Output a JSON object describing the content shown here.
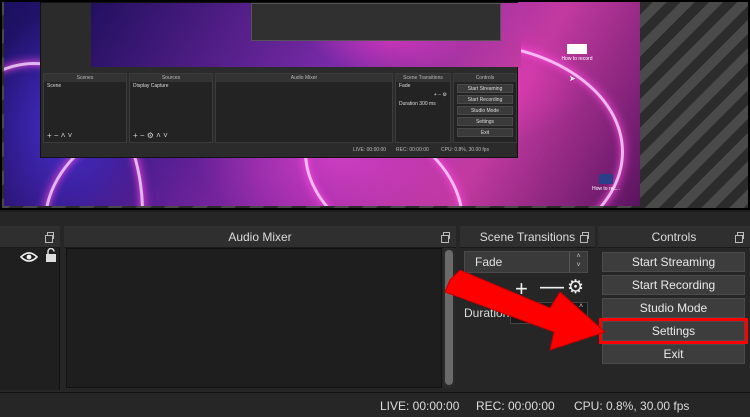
{
  "preview": {
    "mini_panels": {
      "scenes_title": "Scenes",
      "scene_item": "Scene",
      "sources_title": "Sources",
      "source_item": "Display Capture",
      "mixer_title": "Audio Mixer",
      "transitions_title": "Scene Transitions",
      "transition_value": "Fade",
      "duration_label": "Duration",
      "duration_value": "300 ms",
      "controls_title": "Controls",
      "buttons": [
        "Start Streaming",
        "Start Recording",
        "Studio Mode",
        "Settings",
        "Exit"
      ],
      "status_live": "LIVE: 00:00:00",
      "status_rec": "REC: 00:00:00",
      "status_cpu": "CPU: 0.8%, 30.00 fps"
    },
    "desktop_icon_label": "How to record",
    "corner_icon_label": "How to rec..."
  },
  "panels": {
    "audio_mixer": "Audio Mixer",
    "scene_transitions": "Scene Transitions",
    "controls": "Controls"
  },
  "transitions": {
    "selected": "Fade",
    "duration_label": "Duration",
    "add_icon": "plus-icon",
    "remove_icon": "minus-icon",
    "settings_icon": "gear-icon"
  },
  "controls": {
    "start_streaming": "Start Streaming",
    "start_recording": "Start Recording",
    "studio_mode": "Studio Mode",
    "settings": "Settings",
    "exit": "Exit"
  },
  "status": {
    "live": "LIVE: 00:00:00",
    "rec": "REC: 00:00:00",
    "cpu": "CPU: 0.8%, 30.00 fps"
  },
  "colors": {
    "highlight": "#ff0000",
    "panel_bg": "#262626"
  }
}
